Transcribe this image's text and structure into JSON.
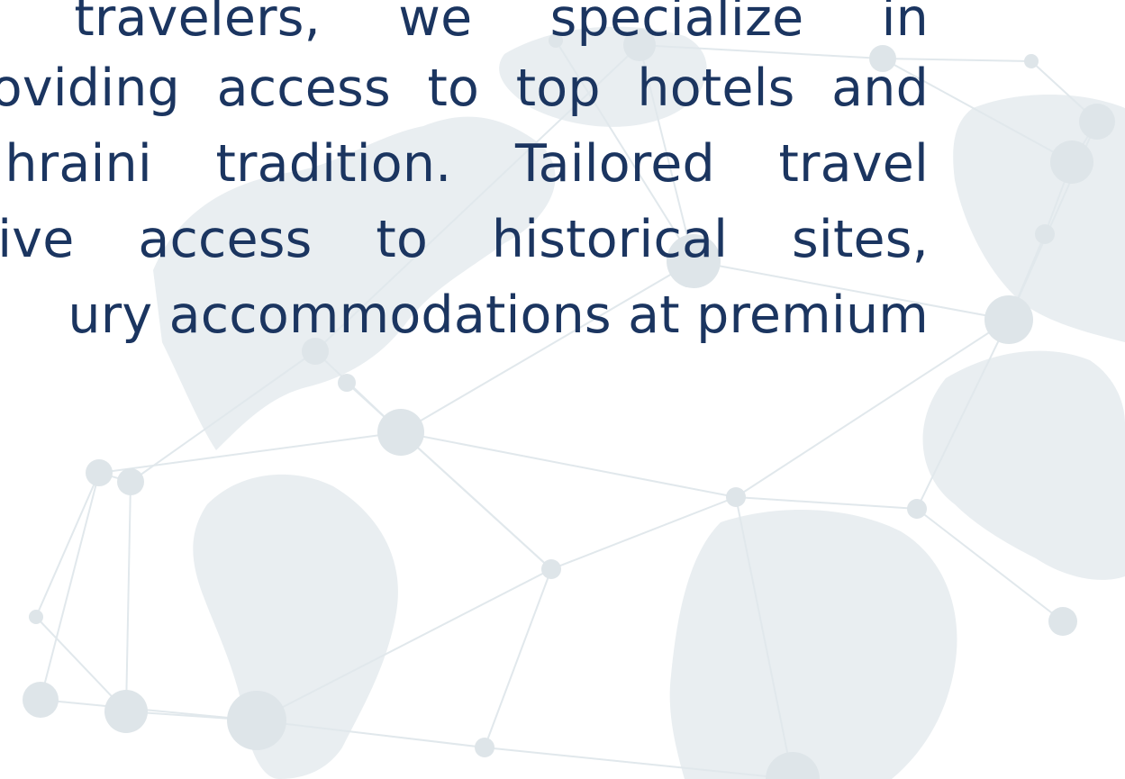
{
  "content": {
    "paragraph_lines": [
      "ess travelers, we specialize in",
      "providing access to top hotels and",
      "Bahraini tradition. Tailored travel",
      "usive access to historical sites,",
      "ury accommodations at premium"
    ]
  },
  "background": {
    "icon": "world-map-network-icon"
  },
  "colors": {
    "text": "#1b3560",
    "map": "#e7ecef",
    "network": "#dfe6ea"
  }
}
